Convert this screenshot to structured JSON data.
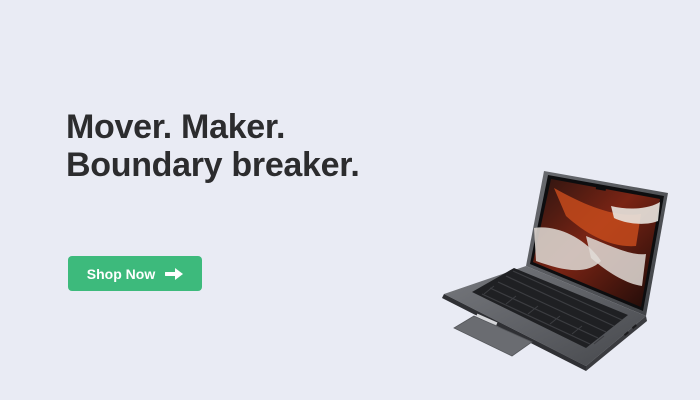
{
  "hero": {
    "headline_line1": "Mover. Maker.",
    "headline_line2": "Boundary breaker.",
    "cta_label": "Shop Now",
    "cta_icon": "arrow-right-icon",
    "product_image": "laptop-image"
  },
  "colors": {
    "background": "#e9ebf4",
    "heading": "#2c2c2e",
    "cta_background": "#3dba7c",
    "cta_text": "#ffffff"
  }
}
